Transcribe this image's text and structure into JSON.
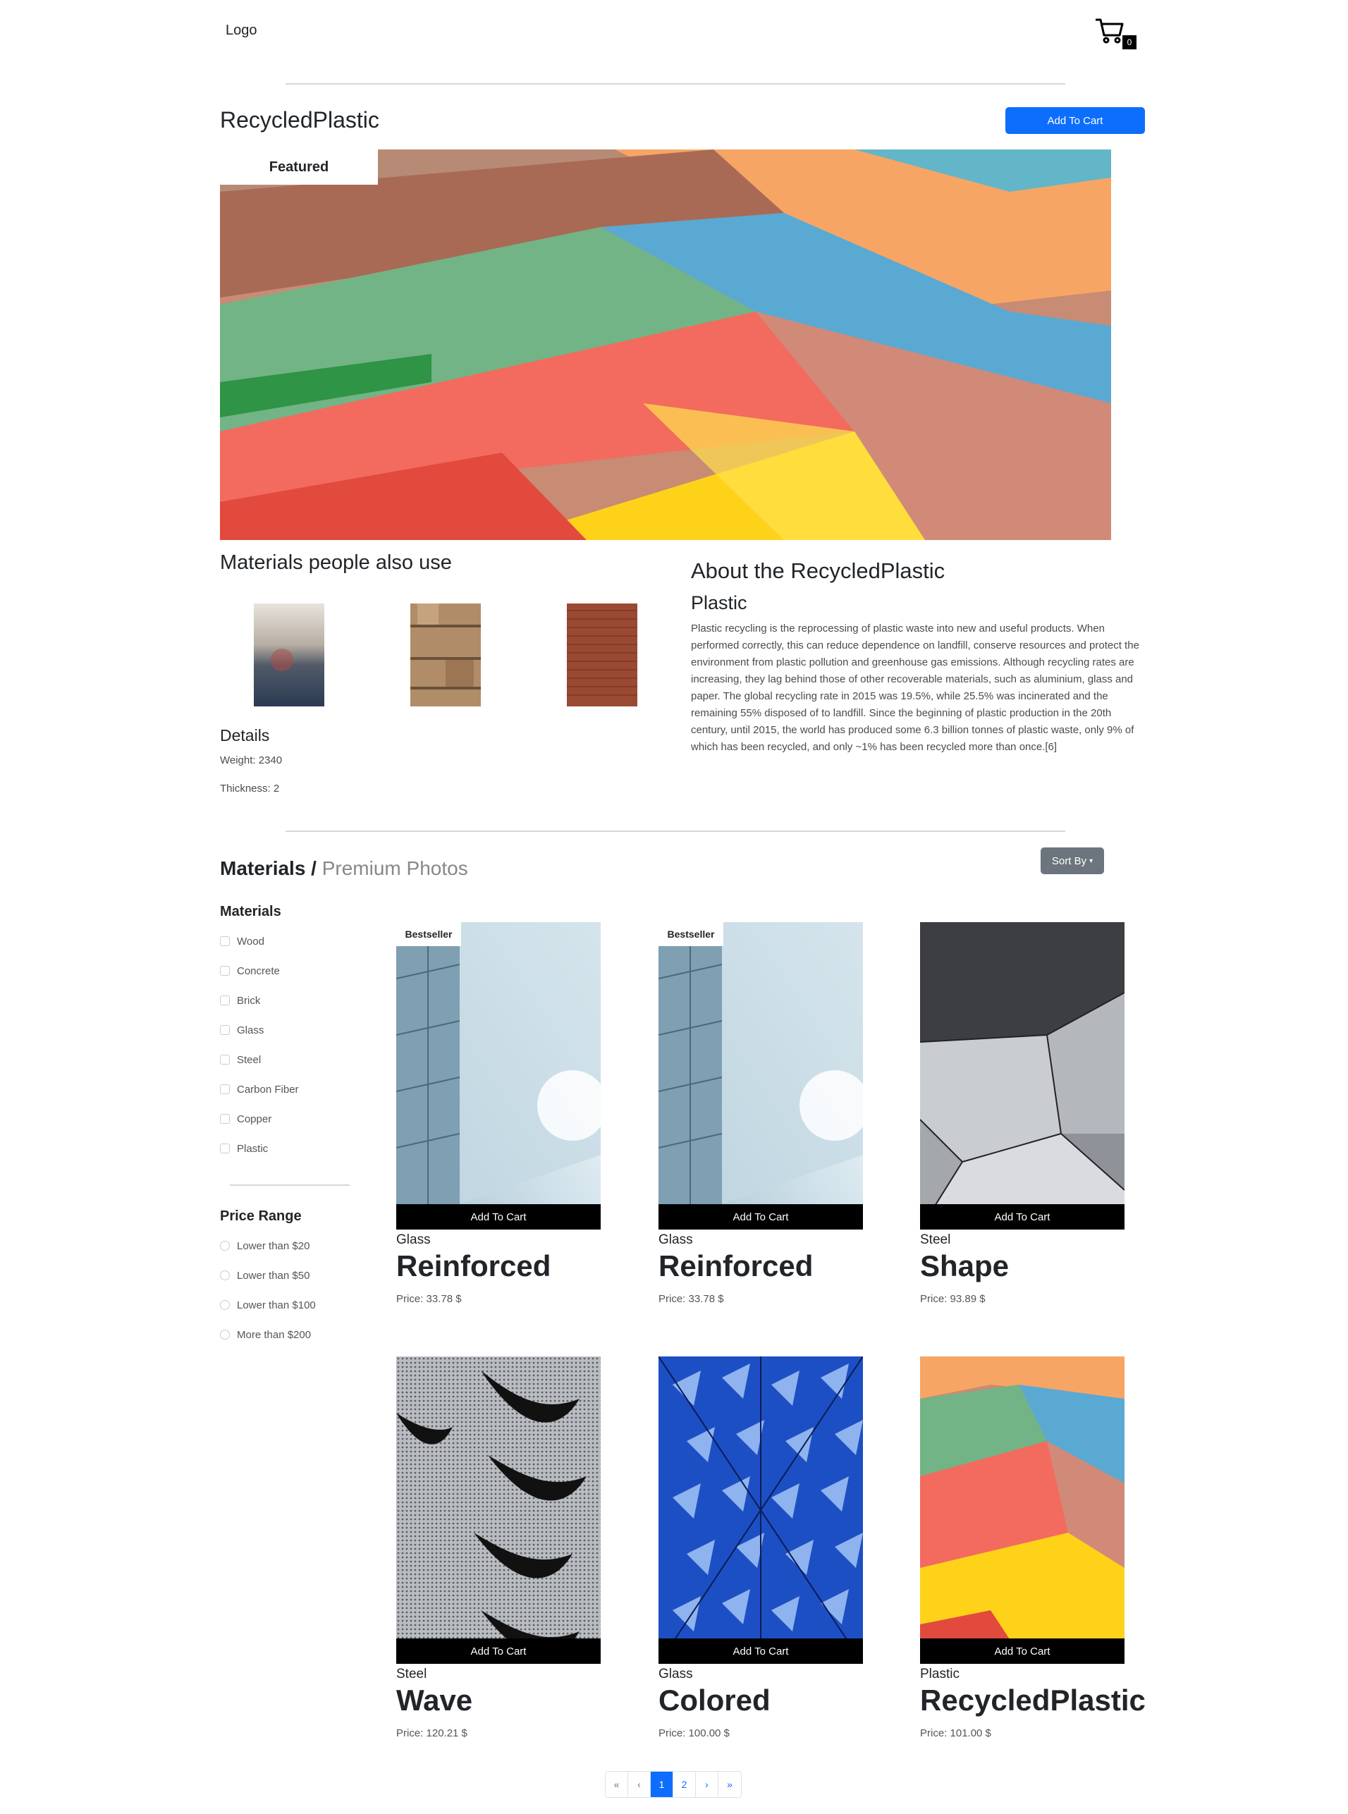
{
  "nav": {
    "logo": "Logo",
    "cart_count": "0"
  },
  "product": {
    "title": "RecycledPlastic",
    "add_to_cart": "Add To Cart",
    "featured": "Featured"
  },
  "also_use": {
    "heading": "Materials people also use"
  },
  "details": {
    "heading": "Details",
    "weight": "Weight: 2340",
    "thickness": "Thickness: 2"
  },
  "about": {
    "heading": "About the RecycledPlastic",
    "subheading": "Plastic",
    "text": "Plastic recycling is the reprocessing of plastic waste into new and useful products. When performed correctly, this can reduce dependence on landfill, conserve resources and protect the environment from plastic pollution and greenhouse gas emissions. Although recycling rates are increasing, they lag behind those of other recoverable materials, such as aluminium, glass and paper. The global recycling rate in 2015 was 19.5%, while 25.5% was incinerated and the remaining 55% disposed of to landfill. Since the beginning of plastic production in the 20th century, until 2015, the world has produced some 6.3 billion tonnes of plastic waste, only 9% of which has been recycled, and only ~1% has been recycled more than once.[6]"
  },
  "listing": {
    "heading_bold": "Materials /",
    "heading_light": "Premium Photos",
    "sort_label": "Sort By"
  },
  "filters": {
    "materials_heading": "Materials",
    "materials": [
      "Wood",
      "Concrete",
      "Brick",
      "Glass",
      "Steel",
      "Carbon Fiber",
      "Copper",
      "Plastic"
    ],
    "price_heading": "Price Range",
    "prices": [
      "Lower than $20",
      "Lower than $50",
      "Lower than $100",
      "More than $200"
    ]
  },
  "cards": [
    {
      "category": "Glass",
      "name": "Reinforced",
      "price": "Price: 33.78 $",
      "badge": "Bestseller",
      "cart": "Add To Cart"
    },
    {
      "category": "Glass",
      "name": "Reinforced",
      "price": "Price: 33.78 $",
      "badge": "Bestseller",
      "cart": "Add To Cart"
    },
    {
      "category": "Steel",
      "name": "Shape",
      "price": "Price: 93.89 $",
      "badge": "",
      "cart": "Add To Cart"
    },
    {
      "category": "Steel",
      "name": "Wave",
      "price": "Price: 120.21 $",
      "badge": "",
      "cart": "Add To Cart"
    },
    {
      "category": "Glass",
      "name": "Colored",
      "price": "Price: 100.00 $",
      "badge": "",
      "cart": "Add To Cart"
    },
    {
      "category": "Plastic",
      "name": "RecycledPlastic",
      "price": "Price: 101.00 $",
      "badge": "",
      "cart": "Add To Cart"
    }
  ],
  "pagination": {
    "first": "«",
    "prev": "‹",
    "p1": "1",
    "p2": "2",
    "next": "›",
    "last": "»"
  }
}
